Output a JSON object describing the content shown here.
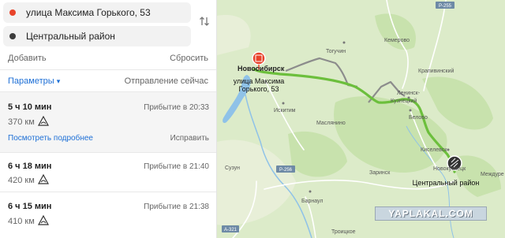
{
  "origin": {
    "value": "улица Максима Горького, 53",
    "dot_color": "#e8432a"
  },
  "destination": {
    "value": "Центральный район",
    "dot_color": "#3c3c3c"
  },
  "actions": {
    "add": "Добавить",
    "reset": "Сбросить"
  },
  "params": {
    "label": "Параметры",
    "caret": "▾",
    "departure": "Отправление сейчас"
  },
  "routes": [
    {
      "time": "5 ч 10 мин",
      "arrival": "Прибытие в 20:33",
      "distance": "370 км",
      "details_link": "Посмотреть подробнее",
      "fix_link": "Исправить"
    },
    {
      "time": "6 ч 18 мин",
      "arrival": "Прибытие в 21:40",
      "distance": "420 км"
    },
    {
      "time": "6 ч 15 мин",
      "arrival": "Прибытие в 21:38",
      "distance": "410 км"
    }
  ],
  "map": {
    "labels": {
      "novosibirsk": "Новосибирск",
      "origin_callout_line1": "улица Максима",
      "origin_callout_line2": "Горького, 53",
      "destination_callout": "Центральный район",
      "toguchin": "Тогучин",
      "kemerovo": "Кемерово",
      "krapivinsky": "Крапивинский",
      "iskitim": "Искитим",
      "maslyanino": "Маслянино",
      "leninsk": "Ленинск-",
      "kuznetsky": "Кузнецкий",
      "belovo": "Белово",
      "kiselevsk": "Киселевск",
      "novokuznetsk": "Новокузнецк",
      "mezhdurechensk": "Междуре",
      "suzun": "Сузун",
      "zarinsk": "Заринск",
      "barnaul": "Барнаул",
      "troitskoe": "Троицкое"
    },
    "shields": {
      "r255_top": "Р-255",
      "r256": "Р-256",
      "a321": "А-321"
    },
    "colors": {
      "route_main": "#6cbf3c",
      "route_alt": "#8c8c8c",
      "water": "#8fc2e8",
      "forest": "#cfe6b8"
    }
  },
  "watermark": "YAPLAKAL.COM"
}
